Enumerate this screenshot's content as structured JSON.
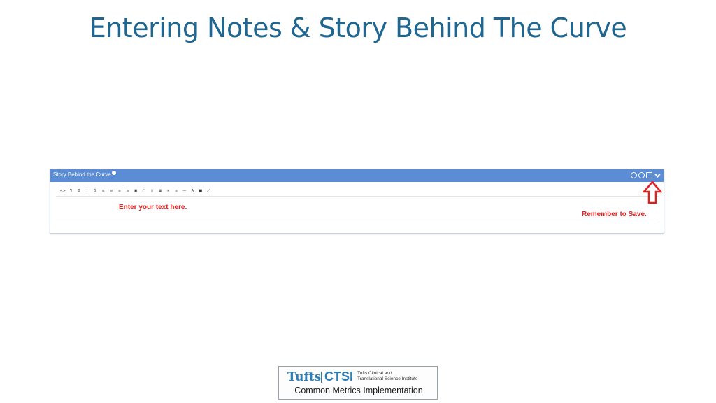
{
  "slide": {
    "title": "Entering Notes & Story Behind The Curve"
  },
  "panel": {
    "title": "Story Behind the Curve",
    "header_icons": [
      "help-icon",
      "cancel-icon",
      "circle-slash-icon",
      "save-icon",
      "chevron-down-icon"
    ],
    "toolbar": [
      {
        "icon": "code-view-icon",
        "glyph": "<>"
      },
      {
        "icon": "paragraph-icon",
        "glyph": "¶"
      },
      {
        "icon": "bold-icon",
        "glyph": "B"
      },
      {
        "icon": "italic-icon",
        "glyph": "I"
      },
      {
        "icon": "strikethrough-icon",
        "glyph": "S"
      },
      {
        "icon": "bulleted-list-icon",
        "glyph": "≡"
      },
      {
        "icon": "numbered-list-icon",
        "glyph": "≡"
      },
      {
        "icon": "outdent-icon",
        "glyph": "≡"
      },
      {
        "icon": "indent-icon",
        "glyph": "≡"
      },
      {
        "icon": "image-icon",
        "glyph": "▣"
      },
      {
        "icon": "video-icon",
        "glyph": "▢"
      },
      {
        "icon": "file-icon",
        "glyph": "▯"
      },
      {
        "icon": "table-icon",
        "glyph": "▦"
      },
      {
        "icon": "link-icon",
        "glyph": "∞"
      },
      {
        "icon": "align-icon",
        "glyph": "≡"
      },
      {
        "icon": "horizontal-rule-icon",
        "glyph": "—"
      },
      {
        "icon": "text-color-icon",
        "glyph": "A"
      },
      {
        "icon": "fullscreen-icon",
        "glyph": "■"
      },
      {
        "icon": "more-icon",
        "glyph": "⤢"
      }
    ],
    "placeholder": "Enter your text here.",
    "annotation": "Remember to Save."
  },
  "logo": {
    "tufts": "Tufts",
    "ctsi": "CTSI",
    "institute_line1": "Tufts Clinical and",
    "institute_line2": "Translational Science Institute",
    "subtitle": "Common Metrics Implementation"
  },
  "colors": {
    "title": "#1f6690",
    "header": "#5b8dd6",
    "annotation": "#e02020",
    "brand": "#2b7fb7"
  }
}
